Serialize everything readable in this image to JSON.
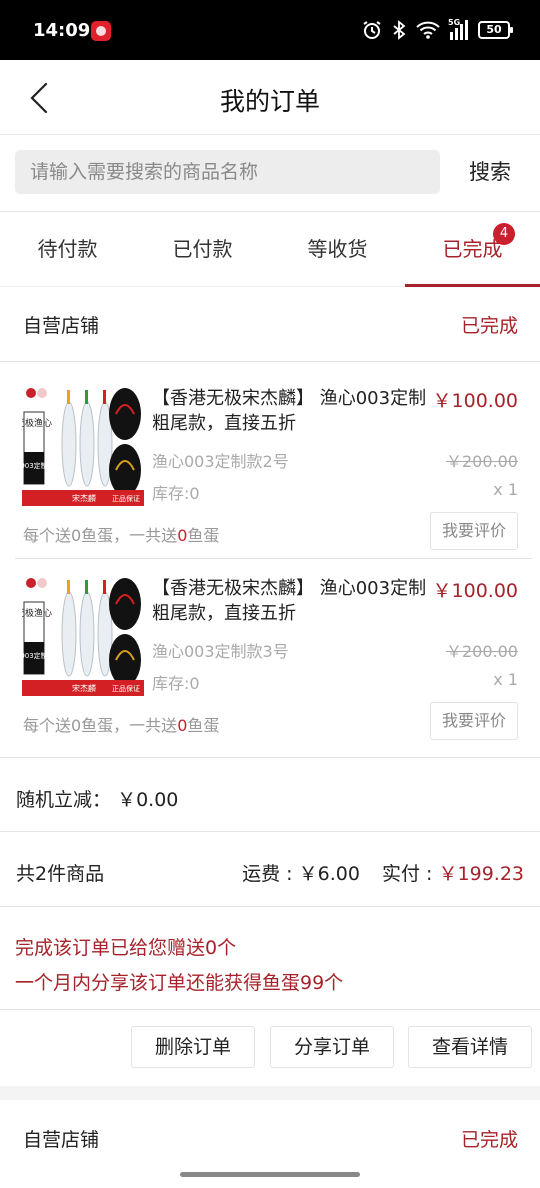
{
  "status_bar": {
    "time": "14:09",
    "battery": "50",
    "network": "5G",
    "icons": [
      "alarm-icon",
      "bluetooth-icon",
      "wifi-icon",
      "signal-icon",
      "battery-icon"
    ]
  },
  "header": {
    "title": "我的订单"
  },
  "search": {
    "placeholder": "请输入需要搜索的商品名称",
    "button_label": "搜索"
  },
  "tabs": [
    {
      "label": "待付款"
    },
    {
      "label": "已付款"
    },
    {
      "label": "等收货"
    },
    {
      "label": "已完成",
      "badge": "4",
      "active": true
    }
  ],
  "orders": [
    {
      "store_name": "自营店铺",
      "status": "已完成",
      "items": [
        {
          "title": "【香港无极宋杰麟】 渔心003定制粗尾款，直接五折",
          "price": "￥100.00",
          "spec": "渔心003定制款2号",
          "original_price": "￥200.00",
          "stock": "库存:0",
          "quantity": "x 1",
          "gift_prefix": "每个送0鱼蛋，一共送",
          "gift_count": "0",
          "gift_suffix": "鱼蛋",
          "review_label": "我要评价"
        },
        {
          "title": "【香港无极宋杰麟】 渔心003定制粗尾款，直接五折",
          "price": "￥100.00",
          "spec": "渔心003定制款3号",
          "original_price": "￥200.00",
          "stock": "库存:0",
          "quantity": "x 1",
          "gift_prefix": "每个送0鱼蛋，一共送",
          "gift_count": "0",
          "gift_suffix": "鱼蛋",
          "review_label": "我要评价"
        }
      ],
      "discount_label": "随机立减：",
      "discount_value": "￥0.00",
      "total_items": "共2件商品",
      "shipping_label": "运费 :",
      "shipping_value": "￥6.00",
      "paid_label": "实付 :",
      "paid_value": "￥199.23",
      "reward_line1": "完成该订单已给您赠送0个",
      "reward_line2": "一个月内分享该订单还能获得鱼蛋99个",
      "actions": {
        "delete": "删除订单",
        "share": "分享订单",
        "detail": "查看详情"
      }
    },
    {
      "store_name": "自营店铺",
      "status": "已完成"
    }
  ],
  "product_image_text": [
    "无极渔心",
    "003定制",
    "宋杰麟",
    "正品保证"
  ],
  "colors": {
    "accent": "#a6232b",
    "badge": "#c8202c",
    "divider": "#e5e5e5"
  }
}
